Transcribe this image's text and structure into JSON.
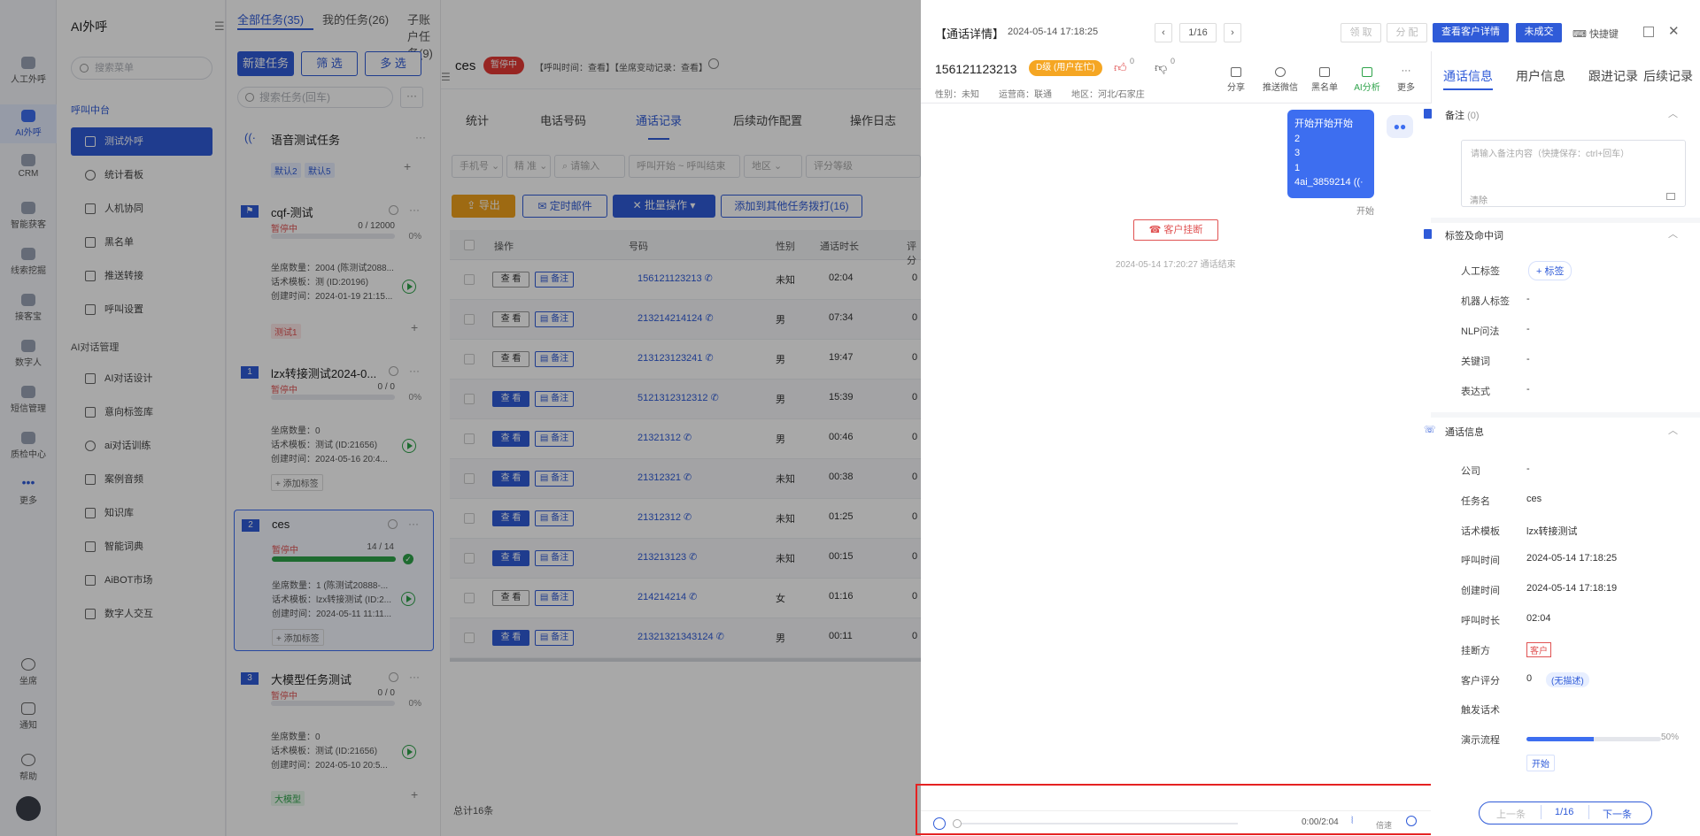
{
  "rail": [
    {
      "label": "人工外呼",
      "active": false
    },
    {
      "label": "AI外呼",
      "active": true
    },
    {
      "label": "CRM",
      "active": false
    },
    {
      "label": "智能获客",
      "active": false
    },
    {
      "label": "线索挖掘",
      "active": false
    },
    {
      "label": "接客宝",
      "active": false
    },
    {
      "label": "数字人",
      "active": false
    },
    {
      "label": "短信管理",
      "active": false
    },
    {
      "label": "质检中心",
      "active": false
    },
    {
      "label": "更多",
      "active": false
    }
  ],
  "rail_bottom": [
    "坐席",
    "通知",
    "帮助"
  ],
  "menu": {
    "title": "AI外呼",
    "search_placeholder": "搜索菜单",
    "group1": "呼叫中台",
    "group1_items": [
      "测试外呼",
      "统计看板",
      "人机协同",
      "黑名单",
      "推送转接",
      "呼叫设置"
    ],
    "group2": "AI对话管理",
    "group2_items": [
      "AI对话设计",
      "意向标签库",
      "ai对话训练",
      "案例音频",
      "知识库",
      "智能词典",
      "AiBOT市场",
      "数字人交互"
    ]
  },
  "tasks": {
    "tabs": [
      "全部任务(35)",
      "我的任务(26)",
      "子账户任务(9)"
    ],
    "new_btn": "新建任务",
    "filter_btn": "筛 选",
    "multi_btn": "多 选",
    "search_placeholder": "搜索任务(回车)",
    "group_title": "语音测试任务",
    "group_tags": [
      "默认2",
      "默认5"
    ],
    "cards": [
      {
        "num": "",
        "name": "cqf-测试",
        "status": "暂停中",
        "count": "0 / 12000",
        "pct": "0%",
        "progress": 0,
        "m1": "坐席数量：2004 (陈测试2088...",
        "m2": "话术模板：测 (ID:20196)",
        "m3": "创建时间：2024-01-19 21:15...",
        "tag": "测试1",
        "tagc": "red"
      },
      {
        "num": "1",
        "name": "lzx转接测试2024-0...",
        "status": "暂停中",
        "count": "0 / 0",
        "pct": "0%",
        "progress": 0,
        "m1": "坐席数量：0",
        "m2": "话术模板：测试 (ID:21656)",
        "m3": "创建时间：2024-05-16 20:4...",
        "tag": "+ 添加标签",
        "tagc": "gray"
      },
      {
        "num": "2",
        "name": "ces",
        "status": "暂停中",
        "count": "14 / 14",
        "pct": "",
        "progress": 1,
        "m1": "坐席数量：1 (陈测试20888-...",
        "m2": "话术模板：lzx转接测试 (ID:2...",
        "m3": "创建时间：2024-05-11 11:11...",
        "tag": "+ 添加标签",
        "tagc": "gray"
      },
      {
        "num": "3",
        "name": "大模型任务测试",
        "status": "暂停中",
        "count": "0 / 0",
        "pct": "0%",
        "progress": 0,
        "m1": "坐席数量：0",
        "m2": "话术模板：测试 (ID:21656)",
        "m3": "创建时间：2024-05-10 20:5...",
        "tag": "大模型",
        "tagc": "green"
      }
    ]
  },
  "mid": {
    "task_name": "ces",
    "status": "暂停中",
    "links": "【呼叫时间：查看】【坐席变动记录：查看】",
    "tabs": [
      "统计",
      "电话号码",
      "通话记录",
      "后续动作配置",
      "操作日志"
    ],
    "active_tab": 2,
    "filters": [
      "手机号",
      "精 准",
      "请输入",
      "呼叫开始 ~ 呼叫结束",
      "地区",
      "评分等级"
    ],
    "actions": [
      "导出",
      "定时邮件",
      "批量操作",
      "添加到其他任务拨打(16)"
    ],
    "headers": [
      "操作",
      "号码",
      "性别",
      "通话时长",
      "评分"
    ],
    "rows": [
      {
        "btn": "查 看",
        "dark": false,
        "phone": "156121123213",
        "gender": "未知",
        "dur": "02:04",
        "score": "0"
      },
      {
        "btn": "查 看",
        "dark": false,
        "phone": "213214214124",
        "gender": "男",
        "dur": "07:34",
        "score": "0"
      },
      {
        "btn": "查 看",
        "dark": false,
        "phone": "213123123241",
        "gender": "男",
        "dur": "19:47",
        "score": "0"
      },
      {
        "btn": "查 看",
        "dark": true,
        "phone": "5121312312312",
        "gender": "男",
        "dur": "15:39",
        "score": "0"
      },
      {
        "btn": "查 看",
        "dark": true,
        "phone": "21321312",
        "gender": "男",
        "dur": "00:46",
        "score": "0"
      },
      {
        "btn": "查 看",
        "dark": true,
        "phone": "21312321",
        "gender": "未知",
        "dur": "00:38",
        "score": "0"
      },
      {
        "btn": "查 看",
        "dark": true,
        "phone": "21312312",
        "gender": "未知",
        "dur": "01:25",
        "score": "0"
      },
      {
        "btn": "查 看",
        "dark": true,
        "phone": "213213123",
        "gender": "未知",
        "dur": "00:15",
        "score": "0"
      },
      {
        "btn": "查 看",
        "dark": false,
        "phone": "214214214",
        "gender": "女",
        "dur": "01:16",
        "score": "0"
      },
      {
        "btn": "查 看",
        "dark": true,
        "phone": "21321321343124",
        "gender": "男",
        "dur": "00:11",
        "score": "0"
      }
    ],
    "note_label": "备注",
    "total": "总计16条"
  },
  "drawer": {
    "title": "【通话详情】",
    "time": "2024-05-14 17:18:25",
    "pager": "1/16",
    "btn_claim": "领 取",
    "btn_assign": "分 配",
    "btn_customer": "查看客户详情",
    "btn_deal": "未成交",
    "btn_shortcut": "快捷键",
    "phone": "156121123213",
    "grade": "D级 (用户在忙)",
    "like_count": "0",
    "dislike_count": "0",
    "gender_info": "性别：未知",
    "carrier_info": "运营商：联通",
    "region_info": "地区：河北/石家庄",
    "tools": [
      "分享",
      "推送微信",
      "黑名单",
      "AI分析",
      "更多"
    ],
    "tabs": [
      "通话信息",
      "用户信息",
      "跟进记录",
      "后续记录"
    ],
    "chat_bubble": [
      "开始开始开始",
      "2",
      "3",
      "1",
      "4ai_3859214"
    ],
    "chat_caption": "开始",
    "hangup": "客户挂断",
    "end_note": "2024-05-14 17:20:27 通话结束",
    "audio_time": "0:00/2:04",
    "audio_speed": "倍速",
    "sec_note": "备注",
    "sec_note_count": "(0)",
    "note_placeholder": "请输入备注内容（快捷保存：ctrl+回车）",
    "note_clear": "清除",
    "sec_tags": "标签及命中词",
    "tag_rows": [
      {
        "label": "人工标签",
        "value": "+ 标签"
      },
      {
        "label": "机器人标签",
        "value": "-"
      },
      {
        "label": "NLP问法",
        "value": "-"
      },
      {
        "label": "关键词",
        "value": "-"
      },
      {
        "label": "表达式",
        "value": "-"
      }
    ],
    "sec_call": "通话信息",
    "call_rows": [
      {
        "label": "公司",
        "value": "-"
      },
      {
        "label": "任务名",
        "value": "ces"
      },
      {
        "label": "话术模板",
        "value": "lzx转接测试"
      },
      {
        "label": "呼叫时间",
        "value": "2024-05-14 17:18:25"
      },
      {
        "label": "创建时间",
        "value": "2024-05-14 17:18:19"
      },
      {
        "label": "呼叫时长",
        "value": "02:04"
      },
      {
        "label": "挂断方",
        "value": "客户"
      },
      {
        "label": "客户评分",
        "value": "0"
      },
      {
        "label": "触发话术",
        "value": ""
      },
      {
        "label": "演示流程",
        "value": ""
      }
    ],
    "score_note": "(无描述)",
    "flow_progress": 0.5,
    "flow_pct": "50%",
    "flow_start": "开始",
    "prev": "上一条",
    "page": "1/16",
    "next": "下一条"
  },
  "colors": {
    "primary": "#2f5bd8",
    "danger": "#e05252",
    "success": "#2ea34a",
    "highlight": "#e52222",
    "grade": "#f5a623"
  }
}
